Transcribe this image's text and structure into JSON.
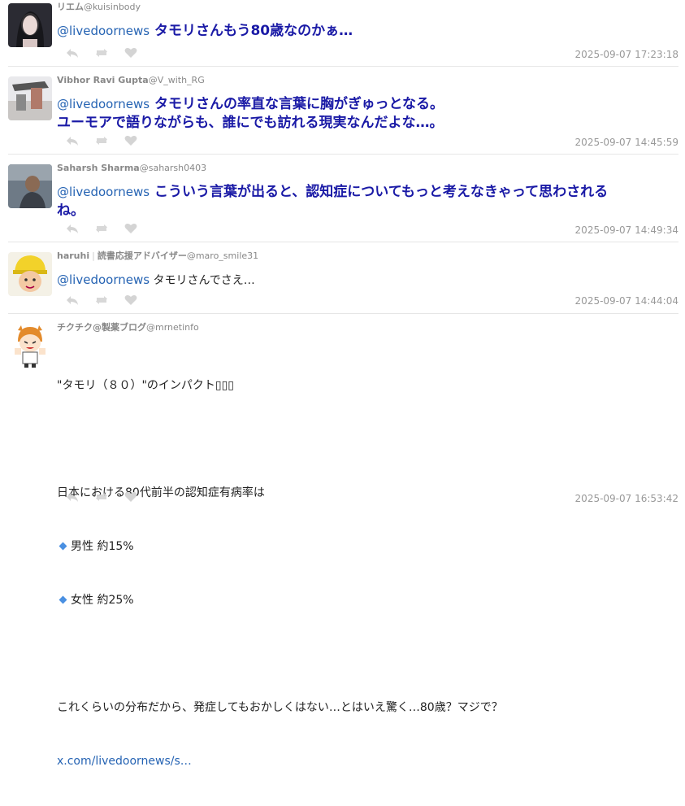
{
  "tweets": [
    {
      "name": "リエム",
      "handle": "@kuisinbody",
      "mention": "@livedoornews",
      "text": "タモリさんもう80歳なのかぁ…",
      "time": "2025-09-07 17:23:18"
    },
    {
      "name": "Vibhor Ravi Gupta",
      "handle": "@V_with_RG",
      "mention": "@livedoornews",
      "text": "タモリさんの率直な言葉に胸がぎゅっとなる。\nユーモアで語りながらも、誰にでも訪れる現実なんだよな…。",
      "time": "2025-09-07 14:45:59"
    },
    {
      "name": "Saharsh Sharma",
      "handle": "@saharsh0403",
      "mention": "@livedoornews",
      "text": "こういう言葉が出ると、認知症についてもっと考えなきゃって思わされる\nね。",
      "time": "2025-09-07 14:49:34"
    },
    {
      "name": "haruhi",
      "name2": "読書応援アドバイザー",
      "handle": "@maro_smile31",
      "mention": "@livedoornews",
      "text": "タモリさんでさえ…",
      "time": "2025-09-07 14:44:04"
    },
    {
      "name": "チクチク@製薬ブログ",
      "handle": "@mrnetinfo",
      "line1": "\"タモリ（８０）\"のインパクト▯▯▯",
      "line2": "日本における80代前半の認知症有病率は",
      "bullet1": "男性 約15%",
      "bullet2": "女性 約25%",
      "line3": "これくらいの分布だから、発症してもおかしくはない…とはいえ驚く…80歳？マジで？",
      "link": "x.com/livedoornews/s…",
      "time": "2025-09-07 16:53:42"
    }
  ],
  "icons": [
    "reply-icon",
    "retweet-icon",
    "like-icon"
  ],
  "colors": {
    "mention": "#2563b3",
    "bold_text": "#1a1aa6",
    "meta": "#999999"
  }
}
